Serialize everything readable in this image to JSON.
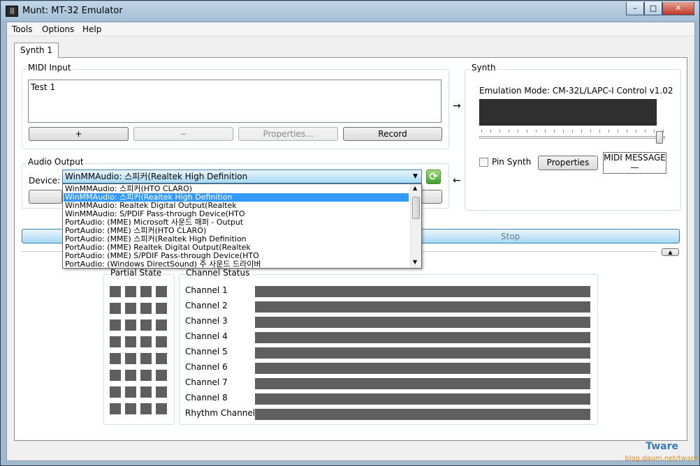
{
  "window": {
    "title": "Munt: MT-32 Emulator",
    "app_icon_text": "|||",
    "minimize_glyph": "–",
    "maximize_glyph": "□",
    "close_glyph": "✕"
  },
  "menu": [
    "Tools",
    "Options",
    "Help"
  ],
  "tab": {
    "label": "Synth 1"
  },
  "midi_input": {
    "group_label": "MIDI Input",
    "items": [
      "Test 1"
    ],
    "add_label": "+",
    "remove_label": "−",
    "properties_label": "Properties...",
    "record_label": "Record"
  },
  "arrows": {
    "right": "→",
    "left": "←"
  },
  "audio_output": {
    "group_label": "Audio Output",
    "device_label": "Device:",
    "selected_device": "WinMMAudio: 스피커(Realtek High Definition",
    "options": [
      "WinMMAudio: 스피커(HTO CLARO)",
      "WinMMAudio: 스피커(Realtek High Definition",
      "WinMMAudio: Realtek Digital Output(Realtek",
      "WinMMAudio: S/PDIF Pass-through Device(HTO",
      "PortAudio: (MME) Microsoft 사운드 매퍼 - Output",
      "PortAudio: (MME) 스피커(HTO CLARO)",
      "PortAudio: (MME) 스피커(Realtek High Definition",
      "PortAudio: (MME) Realtek Digital Output(Realtek",
      "PortAudio: (MME) S/PDIF Pass-through Device(HTO",
      "PortAudio: (Windows DirectSound) 주 사운드 드라이버"
    ],
    "selected_index": 1,
    "refresh_icon": "⟳"
  },
  "synth": {
    "group_label": "Synth",
    "emulation_mode": "Emulation Mode: CM-32L/LAPC-I Control v1.02",
    "volume_level_fraction": 0.99,
    "pin_synth_label": "Pin Synth",
    "pin_synth_checked": false,
    "properties_label": "Properties",
    "midi_message_line1": "MIDI MESSAGE",
    "midi_message_line2": "—"
  },
  "stop_label": "Stop",
  "collapse_glyph": "▲",
  "status": {
    "partial_state_label": "Partial State",
    "channel_status_label": "Channel Status",
    "channels": [
      "Channel 1",
      "Channel 2",
      "Channel 3",
      "Channel 4",
      "Channel 5",
      "Channel 6",
      "Channel 7",
      "Channel 8",
      "Rhythm Channel"
    ]
  },
  "watermark": {
    "title": "Tware",
    "url": "blog.daum.net/tware"
  },
  "colors": {
    "accent": "#3399ff",
    "bar": "#5f5f5f",
    "lcd": "#2f2f2f"
  }
}
